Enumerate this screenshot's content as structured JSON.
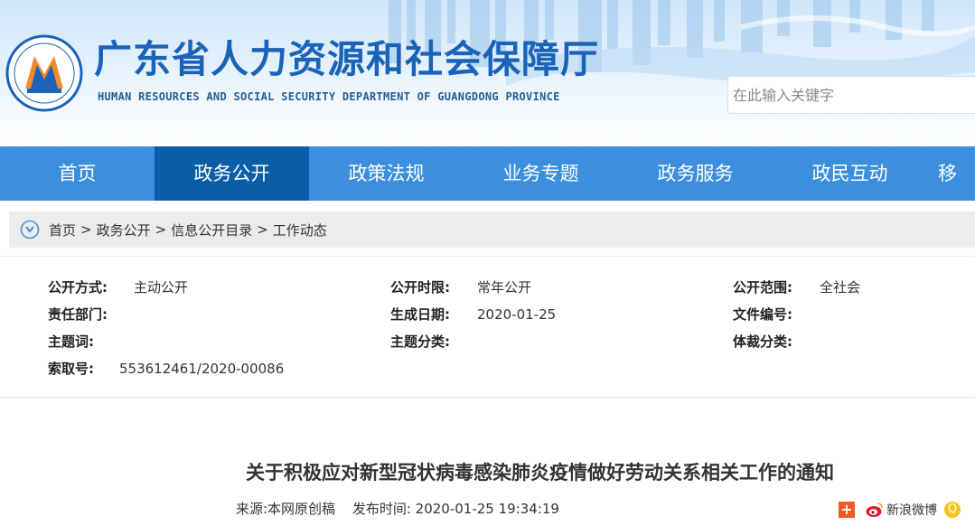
{
  "header": {
    "title": "广东省人力资源和社会保障厅",
    "subtitle": "HUMAN RESOURCES AND SOCIAL SECURITY DEPARTMENT OF GUANGDONG PROVINCE",
    "search_placeholder": "在此输入关键字"
  },
  "nav": {
    "items": [
      "首页",
      "政务公开",
      "政策法规",
      "业务专题",
      "政务服务",
      "政民互动",
      "移"
    ],
    "active_index": 1
  },
  "breadcrumb": {
    "items": [
      "首页",
      "政务公开",
      "信息公开目录",
      "工作动态"
    ],
    "separator": ">"
  },
  "info": {
    "open_mode_label": "公开方式:",
    "open_mode_value": "主动公开",
    "open_time_label": "公开时限:",
    "open_time_value": "常年公开",
    "open_scope_label": "公开范围:",
    "open_scope_value": "全社会",
    "dept_label": "责任部门:",
    "date_label": "生成日期:",
    "date_value": "2020-01-25",
    "doc_no_label": "文件编号:",
    "keywords_label": "主题词:",
    "category_label": "主题分类:",
    "genre_label": "体裁分类:",
    "index_label": "索取号:",
    "index_value": "553612461/2020-00086"
  },
  "article": {
    "title": "关于积极应对新型冠状病毒感染肺炎疫情做好劳动关系相关工作的通知",
    "source": "来源:本网原创稿",
    "published": "发布时间: 2020-01-25 19:34:19"
  },
  "share": {
    "plus": "+",
    "weibo_label": "新浪微博",
    "qzone": "Q"
  },
  "colors": {
    "nav_bg": "#3c8fdc",
    "nav_active": "#0a5ea8",
    "title_blue": "#1a63b8"
  }
}
